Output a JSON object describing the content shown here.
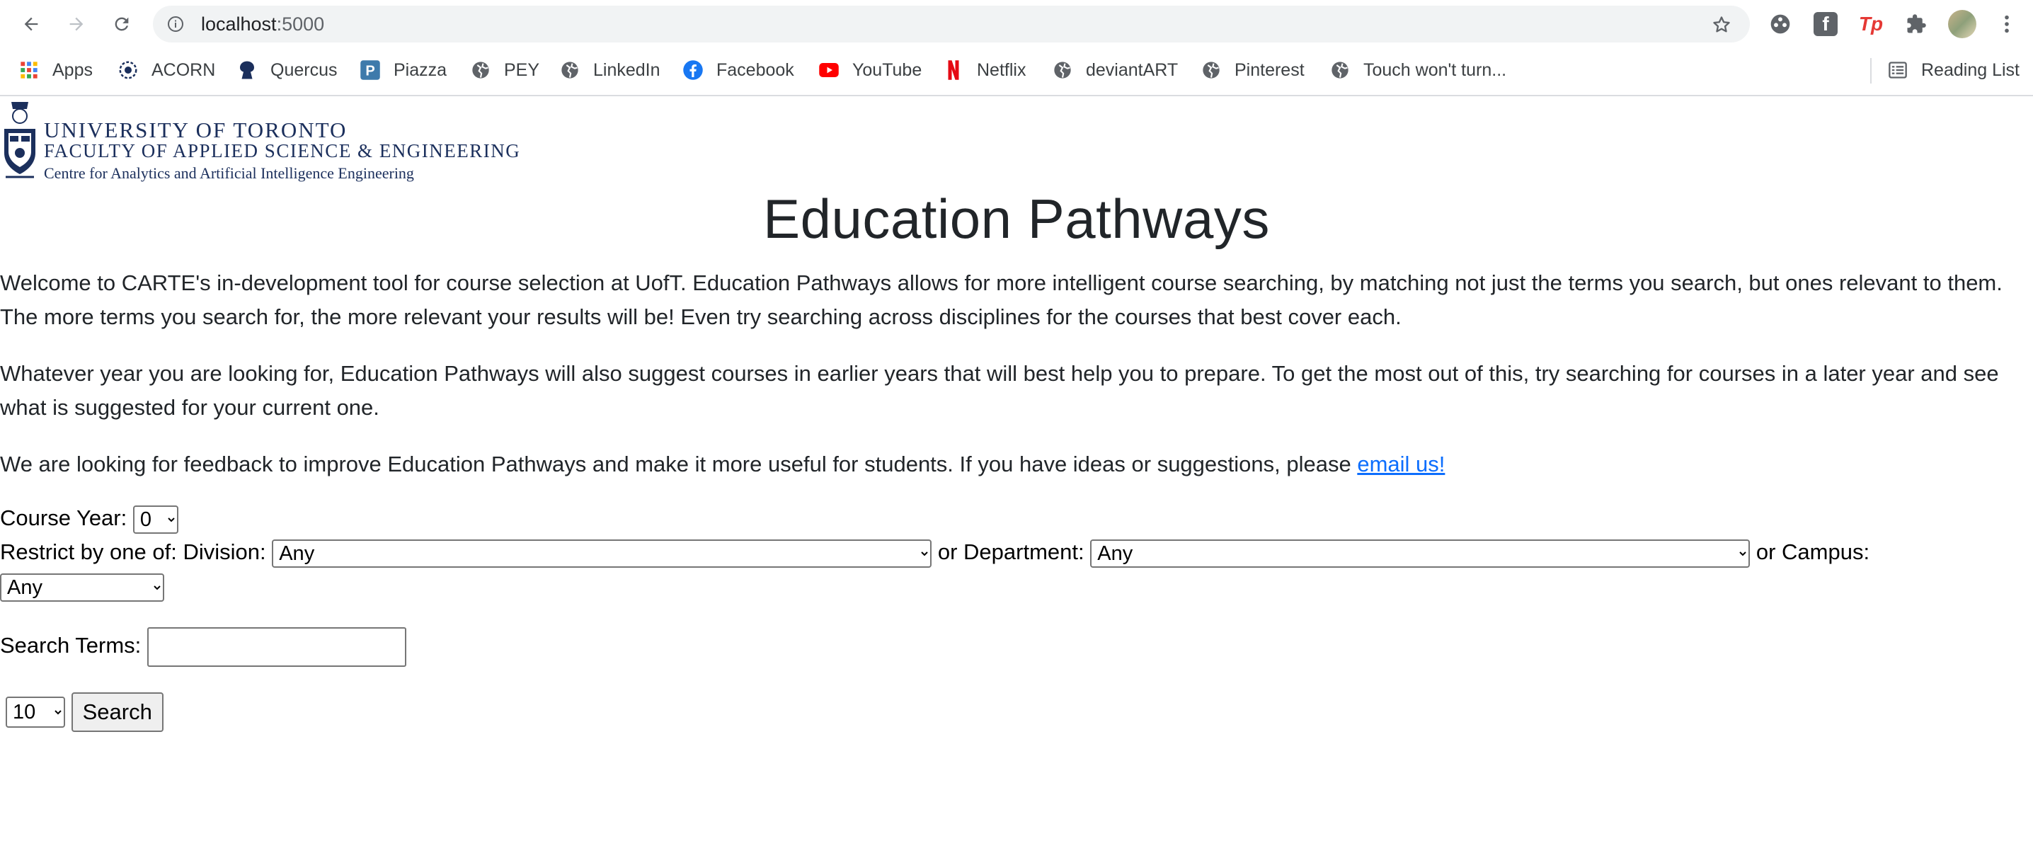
{
  "browser": {
    "url_host": "localhost",
    "url_port": ":5000",
    "reading_list_label": "Reading List",
    "bookmarks": [
      {
        "label": "Apps",
        "icon": "apps-grid-icon"
      },
      {
        "label": "ACORN",
        "icon": "acorn-icon"
      },
      {
        "label": "Quercus",
        "icon": "quercus-icon"
      },
      {
        "label": "Piazza",
        "icon": "piazza-icon"
      },
      {
        "label": "PEY",
        "icon": "globe-icon"
      },
      {
        "label": "LinkedIn",
        "icon": "globe-icon"
      },
      {
        "label": "Facebook",
        "icon": "facebook-icon"
      },
      {
        "label": "YouTube",
        "icon": "youtube-icon"
      },
      {
        "label": "Netflix",
        "icon": "netflix-icon"
      },
      {
        "label": "deviantART",
        "icon": "globe-icon"
      },
      {
        "label": "Pinterest",
        "icon": "globe-icon"
      },
      {
        "label": "Touch won't turn...",
        "icon": "globe-icon"
      }
    ],
    "extension_tp_label": "Tp",
    "extension_f_label": "f"
  },
  "logo": {
    "line1": "UNIVERSITY OF TORONTO",
    "line2": "FACULTY OF APPLIED SCIENCE & ENGINEERING",
    "line3": "Centre for Analytics and Artificial Intelligence Engineering"
  },
  "page": {
    "title": "Education Pathways",
    "para1": "Welcome to CARTE's in-development tool for course selection at UofT. Education Pathways allows for more intelligent course searching, by matching not just the terms you search, but ones relevant to them. The more terms you search for, the more relevant your results will be! Even try searching across disciplines for the courses that best cover each.",
    "para2": "Whatever year you are looking for, Education Pathways will also suggest courses in earlier years that will best help you to prepare. To get the most out of this, try searching for courses in a later year and see what is suggested for your current one.",
    "para3_text": "We are looking for feedback to improve Education Pathways and make it more useful for students. If you have ideas or suggestions, please ",
    "para3_link": "email us!"
  },
  "form": {
    "course_year_label": "Course Year:",
    "course_year_value": "0",
    "restrict_label": "Restrict by one of: Division:",
    "division_value": "Any",
    "department_label": "or Department:",
    "department_value": "Any",
    "campus_label": "or Campus:",
    "campus_value": "Any",
    "search_terms_label": "Search Terms:",
    "search_terms_value": "",
    "results_count_value": "10",
    "search_button_label": "Search"
  },
  "colors": {
    "link": "#0d6efd",
    "logo_navy": "#1b2f5c",
    "youtube_red": "#ff0000",
    "netflix_red": "#e50914",
    "facebook_blue": "#1877f2"
  }
}
